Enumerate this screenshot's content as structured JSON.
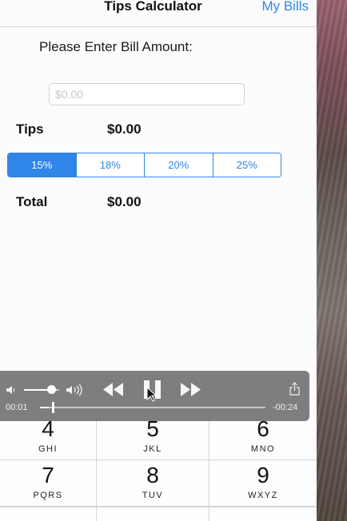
{
  "nav": {
    "title": "Tips Calculator",
    "right_button": "My Bills"
  },
  "form": {
    "prompt": "Please Enter Bill Amount:",
    "bill_placeholder": "$0.00",
    "tips_label": "Tips",
    "tips_value": "$0.00",
    "total_label": "Total",
    "total_value": "$0.00"
  },
  "tip_options": {
    "selected": "15%",
    "items": [
      "15%",
      "18%",
      "20%",
      "25%"
    ]
  },
  "player": {
    "elapsed": "00:01",
    "remaining": "-00:24",
    "volume_level": 0.78,
    "progress": 0.04
  },
  "keyboard": {
    "keys": [
      {
        "num": "4",
        "letters": "GHI"
      },
      {
        "num": "5",
        "letters": "JKL"
      },
      {
        "num": "6",
        "letters": "MNO"
      },
      {
        "num": "7",
        "letters": "PQRS"
      },
      {
        "num": "8",
        "letters": "TUV"
      },
      {
        "num": "9",
        "letters": "WXYZ"
      }
    ]
  },
  "colors": {
    "accent": "#2f86e8",
    "player_bg": "#707072"
  }
}
